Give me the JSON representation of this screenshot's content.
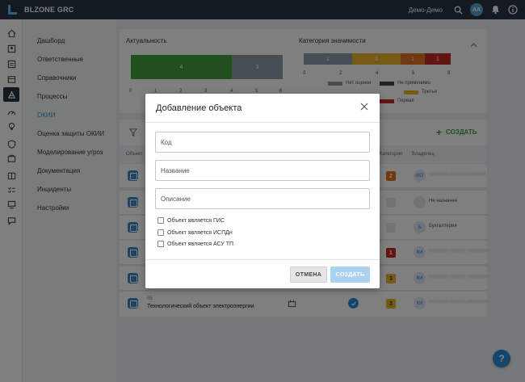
{
  "app": {
    "brand": "BLZONE GRC",
    "user": "Демо-Демо",
    "avatar": "AA"
  },
  "nav": {
    "items": [
      {
        "label": "Дашборд"
      },
      {
        "label": "Ответственные"
      },
      {
        "label": "Справочники"
      },
      {
        "label": "Процессы"
      },
      {
        "label": "ОКИИ"
      },
      {
        "label": "Оценка защиты ОКИИ"
      },
      {
        "label": "Моделирование угроз"
      },
      {
        "label": "Документация"
      },
      {
        "label": "Инциденты"
      },
      {
        "label": "Настройки"
      }
    ],
    "active_index": 4
  },
  "dashboard": {
    "actuality": {
      "title": "Актуальность",
      "segments": [
        {
          "value": 4,
          "color": "#3ea13a"
        },
        {
          "value": 3,
          "color": "#8d9aa6"
        }
      ],
      "ticks": [
        "0",
        "1",
        "2",
        "3",
        "4",
        "5",
        "6",
        "7"
      ]
    },
    "significance": {
      "title": "Категория значимости",
      "segments": [
        {
          "value": 2,
          "color": "#8d9aa6"
        },
        {
          "value": 3,
          "color": "#e8b52a"
        },
        {
          "value": 1,
          "color": "#e0721f"
        },
        {
          "value": 1,
          "color": "#c62828"
        }
      ],
      "ticks": [
        "0",
        "2",
        "4",
        "6",
        "8"
      ],
      "legend": [
        {
          "label": "Нет оценки",
          "color": "#8d9aa6"
        },
        {
          "label": "Не применимо",
          "color": "#37474f"
        },
        {
          "label": "Третья",
          "color": "#e8b52a"
        },
        {
          "label": "Первая",
          "color": "#c62828"
        }
      ]
    }
  },
  "toolbar": {
    "create_label": "СОЗДАТЬ"
  },
  "table": {
    "headers": {
      "object": "Объект",
      "category": "Категория",
      "owner": "Владелец"
    },
    "rows": [
      {
        "category": "2",
        "cat_color": "#e0721f",
        "owner_initials": "ИО",
        "owner": "Иванова Ольга Олеговна"
      },
      {
        "category": "",
        "cat_color": "#e6e8ea",
        "owner_initials": "",
        "owner": "Не назначен"
      },
      {
        "category": "",
        "cat_color": "#e6e8ea",
        "owner_initials": "Б",
        "owner": "Бухгалтерия"
      },
      {
        "category": "1",
        "cat_color": "#c62828",
        "owner_initials": "КИ",
        "owner": "Калинин Кирилл Игоревич"
      },
      {
        "category": "3",
        "cat_color": "#e8b52a",
        "owner_initials": "КИ",
        "owner": "Калинин Кирилл Игоревич"
      },
      {
        "num": "05",
        "name": "Технологический объект электроэнергии",
        "category": "3",
        "cat_color": "#e8b52a",
        "owner_initials": "КИ",
        "owner": "Калинин Кирилл Игоревич"
      }
    ]
  },
  "modal": {
    "title": "Добавление объекта",
    "fields": {
      "code_placeholder": "Код",
      "name_placeholder": "Название",
      "description_placeholder": "Описание"
    },
    "checks": [
      {
        "label": "Объект является ГИС"
      },
      {
        "label": "Объект является ИСПДн"
      },
      {
        "label": "Объект является АСУ ТП"
      }
    ],
    "cancel_label": "ОТМЕНА",
    "create_label": "СОЗДАТЬ"
  },
  "help_label": "?"
}
